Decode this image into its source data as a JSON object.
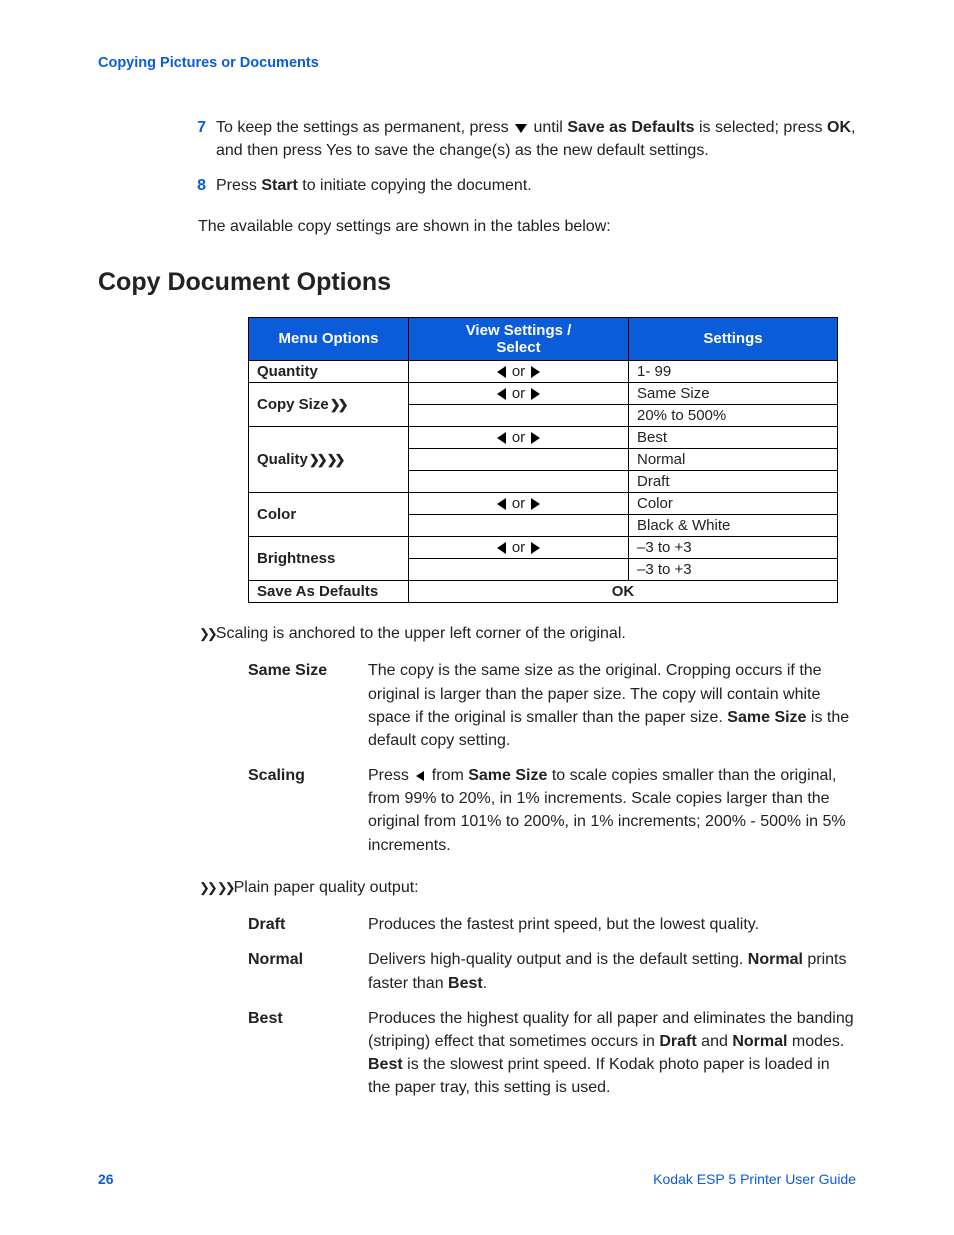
{
  "header": {
    "link": "Copying Pictures or Documents"
  },
  "steps": [
    {
      "num": "7",
      "pre": "To keep the settings as permanent, press ",
      "mid": " until ",
      "bold1": "Save as Defaults",
      "post1": " is selected; press ",
      "bold2": "OK",
      "post2": ", and then press Yes to save the change(s) as the new default settings."
    },
    {
      "num": "8",
      "pre": "Press ",
      "bold1": "Start",
      "post1": " to initiate copying the document."
    }
  ],
  "intro_below": "The available copy settings are shown in the tables below:",
  "section_title": "Copy Document Options",
  "thead": {
    "c1": "Menu Options",
    "c2": "View Settings / Select",
    "c3": "Settings"
  },
  "or": " or ",
  "rows": {
    "quantity": {
      "menu": "Quantity",
      "settings": [
        "1- 99"
      ]
    },
    "copysize": {
      "menu": "Copy Size",
      "settings": [
        "Same Size",
        "20% to 500%"
      ]
    },
    "quality": {
      "menu": "Quality",
      "settings": [
        "Best",
        "Normal",
        "Draft"
      ]
    },
    "color": {
      "menu": "Color",
      "settings": [
        "Color",
        "Black & White"
      ]
    },
    "brightness": {
      "menu": "Brightness",
      "settings": [
        "–3 to +3",
        "–3 to +3"
      ]
    },
    "save": {
      "menu": "Save As Defaults",
      "ok": "OK"
    }
  },
  "fn1": "Scaling is anchored to the upper left corner of the original.",
  "size_defs": {
    "same": {
      "term": "Same Size",
      "t1": "The copy is the same size as the original. Cropping occurs if the original is larger than the paper size. The copy will contain white space if the original is smaller than the paper size. ",
      "b1": "Same Size",
      "t2": " is the default copy setting."
    },
    "scaling": {
      "term": "Scaling",
      "t1": "Press ",
      "t2": " from ",
      "b1": "Same Size",
      "t3": " to scale copies smaller than the original, from 99% to 20%, in 1% increments. Scale copies larger than the original from 101% to 200%, in 1% increments; 200% - 500% in 5% increments."
    }
  },
  "fn2": "Plain paper quality output:",
  "quality_defs": {
    "draft": {
      "term": "Draft",
      "t1": "Produces the fastest print speed, but the lowest quality."
    },
    "normal": {
      "term": "Normal",
      "t1": "Delivers high-quality output and is the default setting. ",
      "b1": "Normal",
      "t2": " prints faster than ",
      "b2": "Best",
      "t3": "."
    },
    "best": {
      "term": "Best",
      "t1": "Produces the highest quality for all paper and eliminates the banding (striping) effect that sometimes occurs in ",
      "b1": "Draft",
      "t2": " and ",
      "b2": "Normal",
      "t3": " modes. ",
      "b3": "Best",
      "t4": " is the slowest print speed. If Kodak photo paper is loaded in the paper tray, this setting is used."
    }
  },
  "footer": {
    "page": "26",
    "guide": "Kodak ESP 5 Printer User Guide"
  }
}
